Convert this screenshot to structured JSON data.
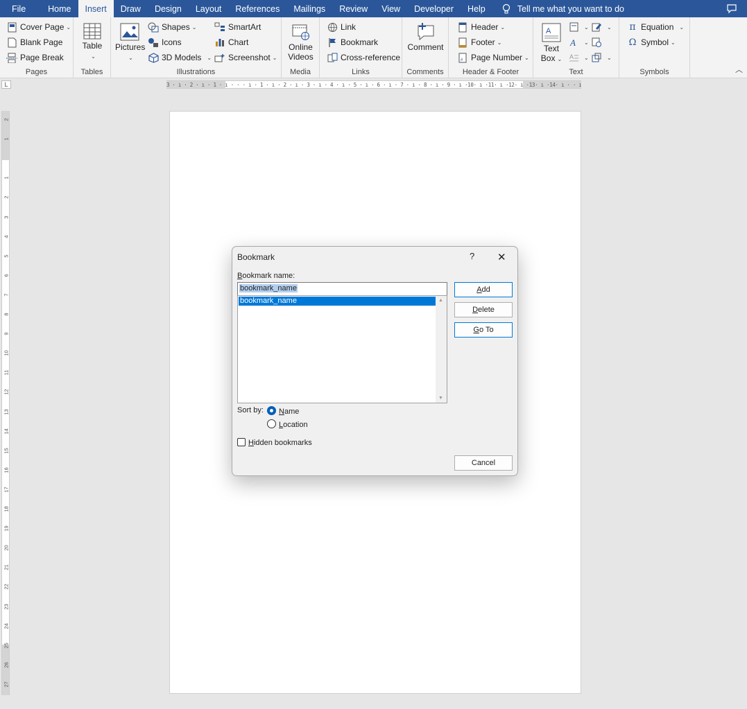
{
  "ribbon_tabs": [
    {
      "label": "File"
    },
    {
      "label": "Home"
    },
    {
      "label": "Insert"
    },
    {
      "label": "Draw"
    },
    {
      "label": "Design"
    },
    {
      "label": "Layout"
    },
    {
      "label": "References"
    },
    {
      "label": "Mailings"
    },
    {
      "label": "Review"
    },
    {
      "label": "View"
    },
    {
      "label": "Developer"
    },
    {
      "label": "Help"
    }
  ],
  "active_tab": "Insert",
  "tell_me": "Tell me what you want to do",
  "groups": {
    "pages": {
      "label": "Pages",
      "cover_page": "Cover Page",
      "blank_page": "Blank Page",
      "page_break": "Page Break"
    },
    "tables": {
      "label": "Tables",
      "table": "Table"
    },
    "illustrations": {
      "label": "Illustrations",
      "pictures": "Pictures",
      "shapes": "Shapes",
      "icons": "Icons",
      "models": "3D Models",
      "smartart": "SmartArt",
      "chart": "Chart",
      "screenshot": "Screenshot"
    },
    "media": {
      "label": "Media",
      "online_videos_1": "Online",
      "online_videos_2": "Videos"
    },
    "links": {
      "label": "Links",
      "link": "Link",
      "bookmark": "Bookmark",
      "cross_reference": "Cross-reference"
    },
    "comments": {
      "label": "Comments",
      "comment": "Comment"
    },
    "header_footer": {
      "label": "Header & Footer",
      "header": "Header",
      "footer": "Footer",
      "page_number": "Page Number"
    },
    "text": {
      "label": "Text",
      "text_box_1": "Text",
      "text_box_2": "Box"
    },
    "symbols": {
      "label": "Symbols",
      "equation": "Equation",
      "symbol": "Symbol"
    }
  },
  "ruler": {
    "horizontal": "3 · ı · 2 · ı · 1 · ı ·  ·  · ı · 1 · ı · 2 · ı · 3 · ı · 4 · ı · 5 · ı · 6 · ı · 7 · ı · 8 · ı · 9 · ı ·10· ı ·11· ı ·12· ı ·13· ı ·14· ı ·  · ı ·16· ı ·17· ı ·",
    "vertical": [
      "2",
      "1",
      "",
      "1",
      "2",
      "3",
      "4",
      "5",
      "6",
      "7",
      "8",
      "9",
      "10",
      "11",
      "12",
      "13",
      "14",
      "15",
      "16",
      "17",
      "18",
      "19",
      "20",
      "21",
      "22",
      "23",
      "24",
      "25",
      "26",
      "27"
    ]
  },
  "dialog": {
    "title": "Bookmark",
    "help": "?",
    "close": "✕",
    "name_label_u": "B",
    "name_label_rest": "ookmark name:",
    "name_value": "bookmark_name",
    "list_items": [
      "bookmark_name"
    ],
    "add_u": "A",
    "add_rest": "dd",
    "delete_u": "D",
    "delete_rest": "elete",
    "goto_u": "G",
    "goto_rest": "o To",
    "sort_by": "Sort by:",
    "sort_name_u": "N",
    "sort_name_rest": "ame",
    "sort_location_u": "L",
    "sort_location_rest": "ocation",
    "sort_selected": "Name",
    "hidden_u": "H",
    "hidden_rest": "idden bookmarks",
    "hidden_checked": false,
    "cancel": "Cancel"
  },
  "colors": {
    "ribbon_blue": "#2b579a",
    "selection": "#0078d7"
  }
}
